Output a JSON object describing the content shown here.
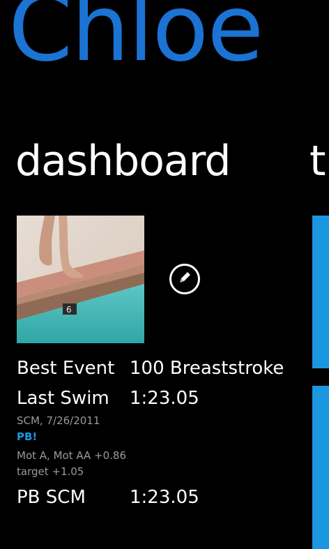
{
  "app": {
    "title": "Chloe"
  },
  "pivot": {
    "current": "dashboard",
    "next_peek": "t"
  },
  "profile": {
    "photo_alt": "swimmer at pool edge",
    "edit_icon": "pencil-icon"
  },
  "stats": {
    "best_event_label": "Best Event",
    "best_event_value": "100 Breaststroke",
    "last_swim_label": "Last Swim",
    "last_swim_value": "1:23.05",
    "last_swim_meta": "SCM, 7/26/2011",
    "pb_flag": "PB!",
    "motivational": "Mot A, Mot AA +0.86",
    "target": "target +1.05",
    "pb_label": "PB SCM",
    "pb_value": "1:23.05"
  },
  "colors": {
    "accent": "#1b73d3",
    "tile": "#1b96e0",
    "pb": "#1b96e0",
    "secondary_text": "#9a9a9a",
    "background": "#000000"
  }
}
